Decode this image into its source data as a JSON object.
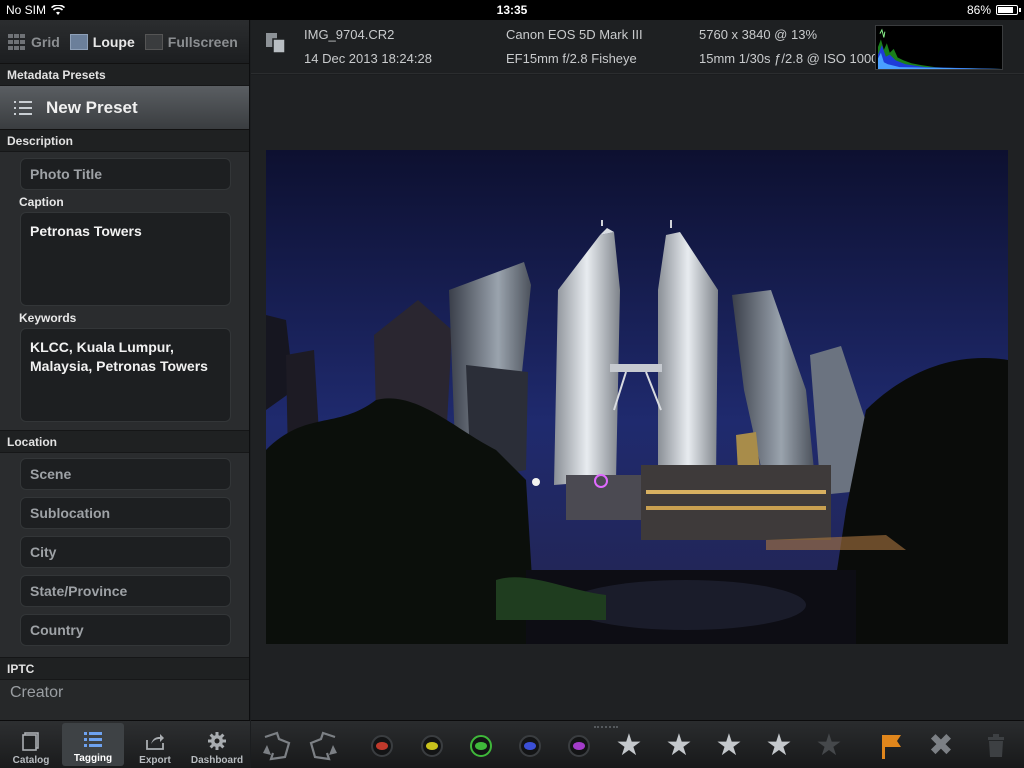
{
  "status": {
    "carrier": "No SIM",
    "time": "13:35",
    "battery": "86%",
    "battery_level": 0.86
  },
  "view_tabs": [
    {
      "label": "Grid",
      "active": false
    },
    {
      "label": "Loupe",
      "active": true
    },
    {
      "label": "Fullscreen",
      "active": false
    }
  ],
  "presets": {
    "heading": "Metadata Presets",
    "button_label": "New Preset"
  },
  "description": {
    "heading": "Description",
    "title_placeholder": "Photo Title",
    "caption_label": "Caption",
    "caption_value": "Petronas Towers",
    "keywords_label": "Keywords",
    "keywords_value": "KLCC, Kuala Lumpur, Malaysia, Petronas Towers"
  },
  "location": {
    "heading": "Location",
    "fields": [
      "Scene",
      "Sublocation",
      "City",
      "State/Province",
      "Country"
    ]
  },
  "iptc": {
    "heading": "IPTC",
    "creator_placeholder": "Creator"
  },
  "bottom_tabs": [
    {
      "label": "Catalog",
      "icon": "catalog-icon",
      "active": false
    },
    {
      "label": "Tagging",
      "icon": "tagging-icon",
      "active": true
    },
    {
      "label": "Export",
      "icon": "export-icon",
      "active": false
    },
    {
      "label": "Dashboard",
      "icon": "gear-icon",
      "active": false
    }
  ],
  "info": {
    "filename": "IMG_9704.CR2",
    "datetime": "14 Dec 2013 18:24:28",
    "camera": "Canon EOS 5D Mark III",
    "lens": "EF15mm f/2.8 Fisheye",
    "dimensions": "5760 x 3840 @ 13%",
    "exposure": "15mm 1/30s ƒ/2.8 @ ISO 1000"
  },
  "toolbar": {
    "color_labels": [
      {
        "name": "red",
        "color": "#c0392b"
      },
      {
        "name": "yellow",
        "color": "#c9c21c"
      },
      {
        "name": "green",
        "color": "#3fb83a"
      },
      {
        "name": "blue",
        "color": "#3b4fd6"
      },
      {
        "name": "purple",
        "color": "#a33cc9"
      }
    ],
    "rating": 4,
    "max_rating": 5,
    "flag_color": "#e0861c"
  }
}
